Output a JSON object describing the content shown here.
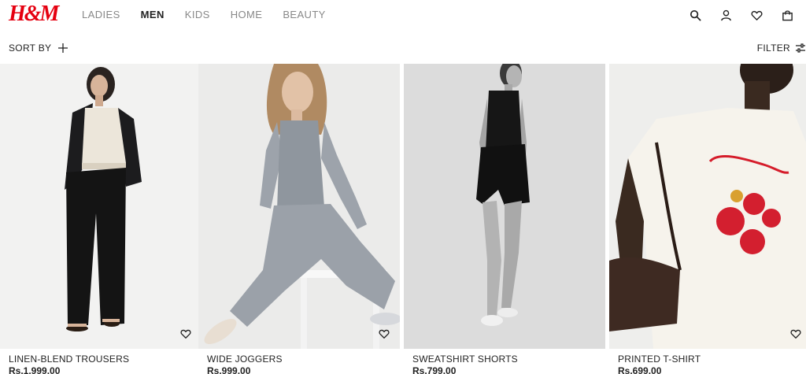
{
  "brand": {
    "logo_text": "H&M",
    "color": "#e50010"
  },
  "nav": {
    "items": [
      {
        "label": "LADIES",
        "active": false
      },
      {
        "label": "MEN",
        "active": true
      },
      {
        "label": "KIDS",
        "active": false
      },
      {
        "label": "HOME",
        "active": false
      },
      {
        "label": "BEAUTY",
        "active": false
      }
    ]
  },
  "header_icons": [
    "search-icon",
    "account-icon",
    "favourites-icon",
    "shopping-bag-icon"
  ],
  "toolbar": {
    "sort_label": "SORT BY",
    "filter_label": "FILTER"
  },
  "products": [
    {
      "title": "LINEN-BLEND TROUSERS",
      "price": "Rs.1,999.00",
      "photo": "woman in black linen trousers and cream camisole with black blazer"
    },
    {
      "title": "WIDE JOGGERS",
      "price": "Rs.999.00",
      "photo": "woman in grey knit tank and wide grey joggers seated"
    },
    {
      "title": "SWEATSHIRT SHORTS",
      "price": "Rs.799.00",
      "photo": "woman in black tank and black shorts, black and white photo"
    },
    {
      "title": "PRINTED T-SHIRT",
      "price": "Rs.699.00",
      "photo": "woman in white printed t-shirt with brown bag"
    }
  ]
}
